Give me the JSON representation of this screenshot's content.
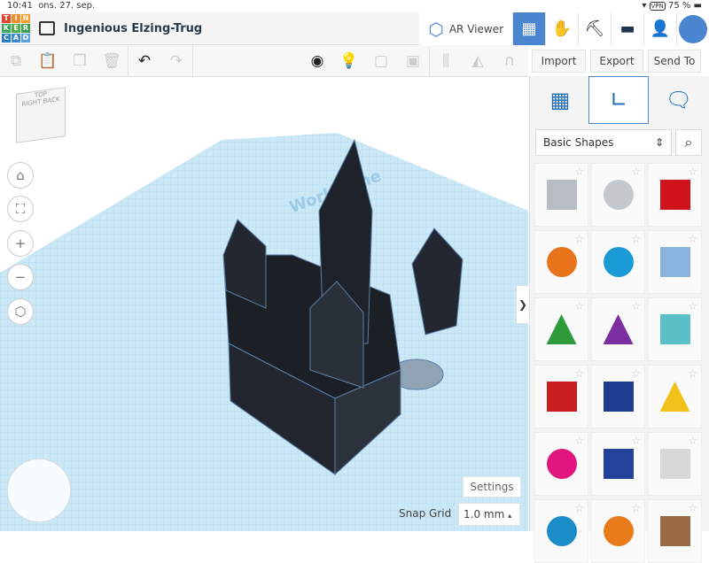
{
  "status": {
    "time": "10:41",
    "date": "ons. 27. sep.",
    "vpn": "VPN",
    "battery": "75 %"
  },
  "logo": [
    "T",
    "I",
    "N",
    "K",
    "E",
    "R",
    "C",
    "A",
    "D"
  ],
  "header": {
    "title": "Ingenious Elzing-Trug",
    "ar_viewer": "AR Viewer"
  },
  "toolbar": {
    "import": "Import",
    "export": "Export",
    "send_to": "Send To"
  },
  "viewcube": {
    "top": "TOP",
    "front": "RIGHT",
    "back": "BACK"
  },
  "workplane": {
    "label": "Workplane",
    "settings": "Settings",
    "snap_label": "Snap Grid",
    "snap_value": "1.0 mm"
  },
  "panel": {
    "category": "Basic Shapes",
    "toggle": "❯"
  },
  "shapes": [
    {
      "name": "box-hole",
      "color": "#b8bcc4"
    },
    {
      "name": "cylinder-hole",
      "color": "#c4c8cc"
    },
    {
      "name": "box",
      "color": "#d0131b"
    },
    {
      "name": "cylinder",
      "color": "#e8731a"
    },
    {
      "name": "sphere",
      "color": "#1a9bd6"
    },
    {
      "name": "scribble",
      "color": "#8ab4e0"
    },
    {
      "name": "roof",
      "color": "#2e9c3a"
    },
    {
      "name": "cone",
      "color": "#7a2ea0"
    },
    {
      "name": "round-roof",
      "color": "#5bc0c8"
    },
    {
      "name": "text",
      "color": "#c81e1e"
    },
    {
      "name": "polygon",
      "color": "#1e3d8f"
    },
    {
      "name": "pyramid",
      "color": "#f2c21a"
    },
    {
      "name": "half-sphere",
      "color": "#e0167e"
    },
    {
      "name": "hexagonal-prism",
      "color": "#22429c"
    },
    {
      "name": "paraboloid",
      "color": "#d8d8d8"
    },
    {
      "name": "torus",
      "color": "#1a8cc8"
    },
    {
      "name": "tube",
      "color": "#e87c1a"
    },
    {
      "name": "heart",
      "color": "#9a6a44"
    }
  ],
  "colors": {
    "accent": "#4a86d0",
    "plane": "#c7e6f6"
  }
}
